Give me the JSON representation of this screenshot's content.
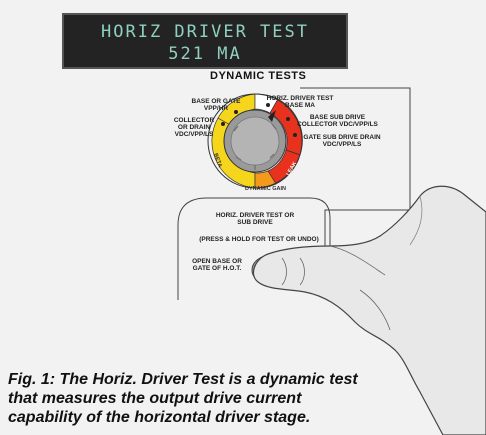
{
  "display": {
    "line1": "HORIZ DRIVER TEST",
    "line2": "521 MA"
  },
  "panel": {
    "title": "DYNAMIC TESTS",
    "knob_positions": {
      "base_gate": "BASE OR GATE VPP/HR",
      "collector": "COLLECTOR OR DRAIN VDC/VPP/LS",
      "horiz_driver": "HORIZ. DRIVER TEST BASE MA",
      "base_sub": "BASE SUB DRIVE COLLECTOR VDC/VPP/LS",
      "gate_sub": "GATE SUB DRIVE DRAIN VDC/VPP/LS"
    },
    "ring_labels": {
      "yellow": "BETA",
      "bottom": "DYNAMIC GAIN",
      "red": "LEAK"
    },
    "button_box": {
      "title": "HORIZ. DRIVER TEST OR SUB DRIVE",
      "instruction": "(PRESS & HOLD FOR TEST OR UNDO)",
      "side_label": "OPEN BASE OR GATE OF H.O.T."
    }
  },
  "caption": "Fig. 1: The Horiz. Driver Test is a dynamic test that measures the output drive current capability of the horizontal driver stage.",
  "colors": {
    "background": "#f2f2f2",
    "lcd_bg": "#232323",
    "lcd_text": "#8fd0c0",
    "ring_yellow": "#f6d51d",
    "ring_red": "#e8321e",
    "ring_orange": "#f39a1c",
    "knob": "#9a9a9a"
  }
}
